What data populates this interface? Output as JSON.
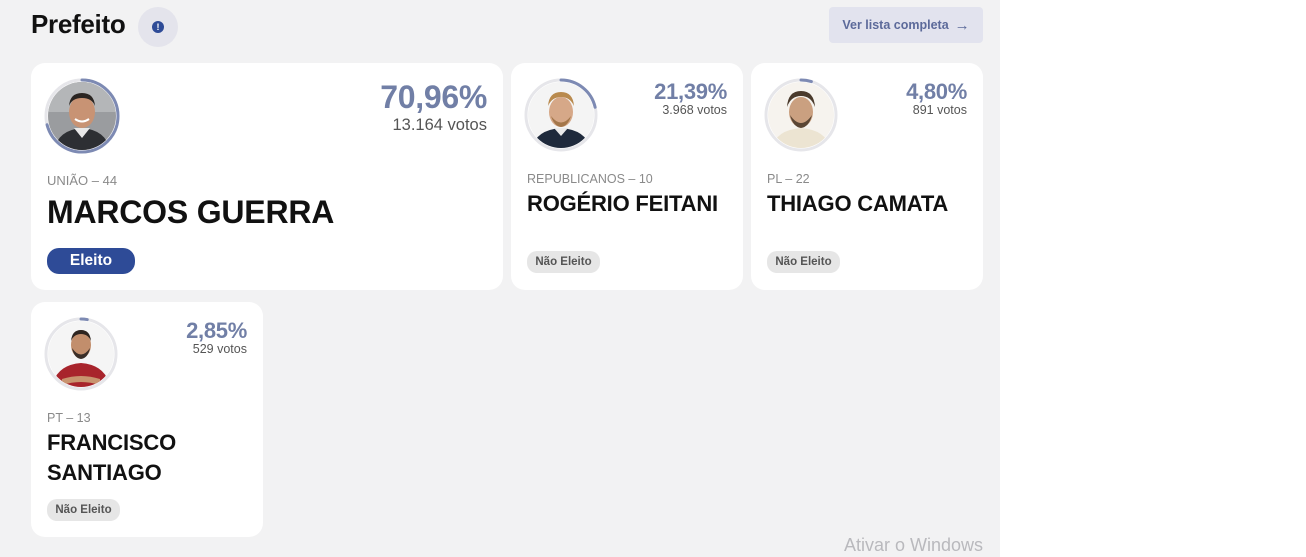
{
  "header": {
    "title": "Prefeito",
    "info_icon": "!",
    "list_button_label": "Ver lista completa",
    "list_button_icon": "arrow-right-icon"
  },
  "candidates": [
    {
      "percent": "70,96%",
      "votes": "13.164 votos",
      "party": "UNIÃO – 44",
      "name": "MARCOS GUERRA",
      "status": "Eleito",
      "vote_share": 0.7096
    },
    {
      "percent": "21,39%",
      "votes": "3.968 votos",
      "party": "REPUBLICANOS – 10",
      "name": "ROGÉRIO FEITANI",
      "status": "Não Eleito",
      "vote_share": 0.2139
    },
    {
      "percent": "4,80%",
      "votes": "891 votos",
      "party": "PL – 22",
      "name": "THIAGO CAMATA",
      "status": "Não Eleito",
      "vote_share": 0.048
    },
    {
      "percent": "2,85%",
      "votes": "529 votos",
      "party": "PT – 13",
      "name_line1": "FRANCISCO",
      "name_line2": "SANTIAGO",
      "status": "Não Eleito",
      "vote_share": 0.0285
    }
  ],
  "colors": {
    "accent": "#2e4b97",
    "percent_text": "#717fa6",
    "progress_ring": "#7d8ab3"
  },
  "watermark": "Ativar o Windows"
}
